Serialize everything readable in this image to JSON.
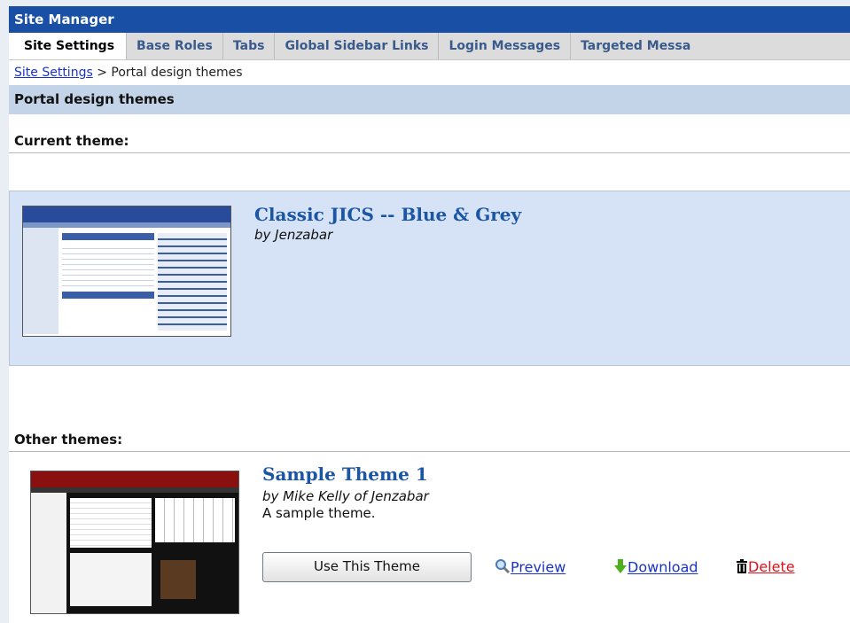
{
  "app": {
    "title": "Site Manager"
  },
  "tabs": [
    {
      "label": "Site Settings"
    },
    {
      "label": "Base Roles"
    },
    {
      "label": "Tabs"
    },
    {
      "label": "Global Sidebar Links"
    },
    {
      "label": "Login Messages"
    },
    {
      "label": "Targeted Messa"
    }
  ],
  "breadcrumb": {
    "link": "Site Settings",
    "separator": ">",
    "current": "Portal design themes"
  },
  "section": {
    "title": "Portal design themes"
  },
  "current": {
    "heading": "Current theme:",
    "theme": {
      "name": "Classic JICS -- Blue & Grey",
      "author": "by Jenzabar"
    }
  },
  "other": {
    "heading": "Other themes:",
    "themes": [
      {
        "name": "Sample Theme 1",
        "author": "by Mike Kelly of Jenzabar",
        "description": "A sample theme.",
        "use_label": "Use This Theme",
        "preview_label": "Preview",
        "download_label": "Download",
        "delete_label": "Delete"
      }
    ]
  },
  "colors": {
    "header": "#1a4fa6",
    "link": "#1a33c7",
    "delete": "#e0101a",
    "current_bg": "#d6e2f6",
    "section_bg": "#c3d4e8"
  },
  "icons": [
    "magnifier-icon",
    "download-arrow-icon",
    "trash-icon"
  ]
}
